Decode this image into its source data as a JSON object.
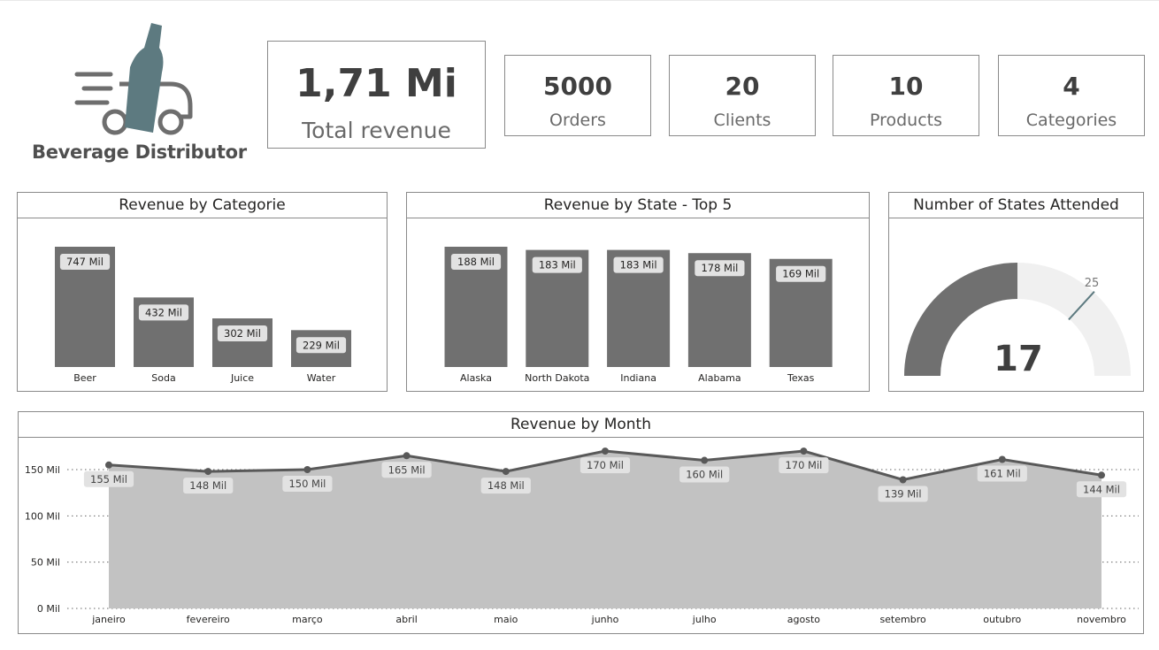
{
  "brand": {
    "name": "Beverage Distributor",
    "icon": "truck-bottle-icon",
    "bottle_color": "#5d7a80",
    "truck_color": "#6e6e6e"
  },
  "kpis": {
    "total_revenue": {
      "value": "1,71 Mi",
      "label": "Total revenue"
    },
    "orders": {
      "value": "5000",
      "label": "Orders"
    },
    "clients": {
      "value": "20",
      "label": "Clients"
    },
    "products": {
      "value": "10",
      "label": "Products"
    },
    "categories": {
      "value": "4",
      "label": "Categories"
    }
  },
  "colors": {
    "bar": "#707070",
    "data_label_bg": "#e2e2e2",
    "area": "#c2c2c2",
    "line": "#595959",
    "gauge_fill": "#707070",
    "gauge_track": "#f0f0f0",
    "gauge_target": "#5d7a80"
  },
  "chart_data": [
    {
      "type": "bar",
      "title": "Revenue by Categorie",
      "categories": [
        "Beer",
        "Soda",
        "Juice",
        "Water"
      ],
      "values": [
        747,
        432,
        302,
        229
      ],
      "data_labels": [
        "747 Mil",
        "432 Mil",
        "302 Mil",
        "229 Mil"
      ]
    },
    {
      "type": "bar",
      "title": "Revenue by State - Top 5",
      "categories": [
        "Alaska",
        "North Dakota",
        "Indiana",
        "Alabama",
        "Texas"
      ],
      "values": [
        188,
        183,
        183,
        178,
        169
      ],
      "data_labels": [
        "188 Mil",
        "183 Mil",
        "183 Mil",
        "178 Mil",
        "169 Mil"
      ]
    },
    {
      "type": "gauge",
      "title": "Number of States Attended",
      "value": 17,
      "value_label": "17",
      "target": 25,
      "target_label": "25",
      "max": 34
    },
    {
      "type": "area",
      "title": "Revenue by Month",
      "x": [
        "janeiro",
        "fevereiro",
        "março",
        "abril",
        "maio",
        "junho",
        "julho",
        "agosto",
        "setembro",
        "outubro",
        "novembro"
      ],
      "values": [
        155,
        148,
        150,
        165,
        148,
        170,
        160,
        170,
        139,
        161,
        144
      ],
      "data_labels": [
        "155 Mil",
        "148 Mil",
        "150 Mil",
        "165 Mil",
        "148 Mil",
        "170 Mil",
        "160 Mil",
        "170 Mil",
        "139 Mil",
        "161 Mil",
        "144 Mil"
      ],
      "yticks": [
        0,
        50,
        100,
        150
      ],
      "ytick_labels": [
        "0 Mil",
        "50 Mil",
        "100 Mil",
        "150 Mil"
      ],
      "ylim": [
        0,
        180
      ],
      "grid": true
    }
  ]
}
